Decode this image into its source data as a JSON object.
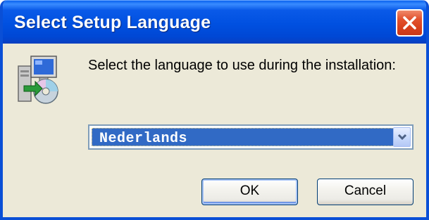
{
  "window": {
    "title": "Select Setup Language"
  },
  "dialog": {
    "prompt": "Select the language to use during the installation:",
    "language_select": {
      "selected": "Nederlands"
    },
    "ok_label": "OK",
    "cancel_label": "Cancel"
  },
  "icons": {
    "close": "close-icon",
    "setup": "setup-computer-icon",
    "dropdown": "chevron-down-icon"
  },
  "colors": {
    "titlebar": "#0050e0",
    "close_button": "#d8401c",
    "dialog_background": "#ece9d8",
    "selection": "#316ac5"
  }
}
